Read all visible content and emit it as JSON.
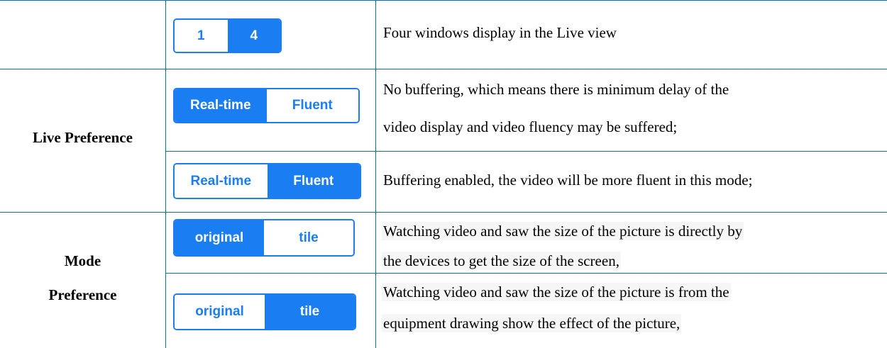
{
  "rows": [
    {
      "row_label": "",
      "toggle": {
        "options": [
          "1",
          "4"
        ],
        "active": 1
      },
      "description": [
        "Four windows display in the Live view"
      ]
    },
    {
      "row_label": "Live Preference",
      "toggle": {
        "options": [
          "Real-time",
          "Fluent"
        ],
        "active": 0
      },
      "description": [
        "No buffering, which means there is minimum delay of the",
        "video display and video fluency may be suffered;"
      ]
    },
    {
      "toggle": {
        "options": [
          "Real-time",
          "Fluent"
        ],
        "active": 1
      },
      "description": [
        "Buffering enabled, the video will be more fluent in this mode;"
      ]
    },
    {
      "row_label_lines": [
        "Mode",
        "Preference"
      ],
      "toggle": {
        "options": [
          "original",
          "tile"
        ],
        "active": 0
      },
      "description": [
        "Watching video and saw the size of the picture is directly by",
        "the devices to get the size of the screen,"
      ]
    },
    {
      "toggle": {
        "options": [
          "original",
          "tile"
        ],
        "active": 1
      },
      "description": [
        "Watching video and saw the size of the picture is from the",
        "equipment drawing show the effect of the picture,"
      ]
    }
  ],
  "colors": {
    "border": "#0070c0",
    "toggle_accent": "#1a7df2"
  }
}
